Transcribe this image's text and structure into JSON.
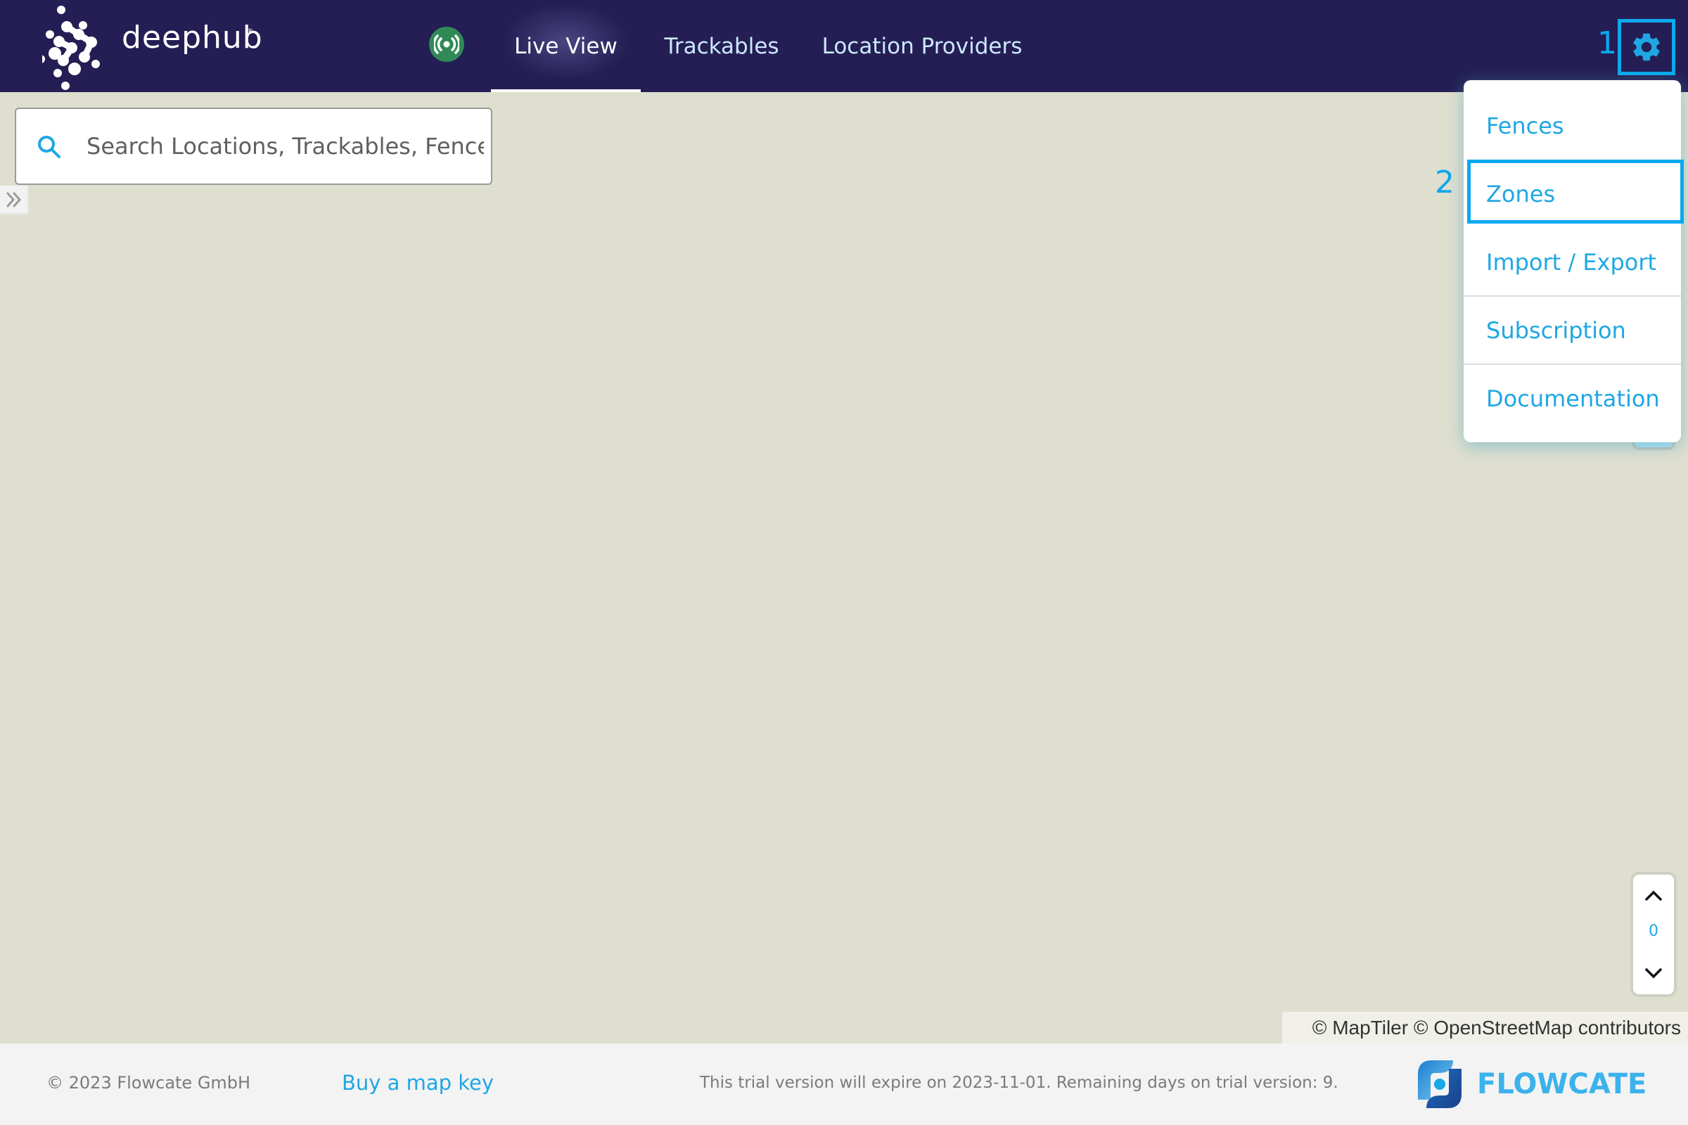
{
  "header": {
    "brand": "deephub",
    "brand_mark": "®",
    "status_icon": "broadcast-icon",
    "nav": [
      {
        "label": "Live View",
        "active": true
      },
      {
        "label": "Trackables",
        "active": false
      },
      {
        "label": "Location Providers",
        "active": false
      }
    ],
    "settings_icon": "gear-icon"
  },
  "annotations": {
    "step1": "1",
    "step2": "2",
    "highlight_color": "#0aa9ee"
  },
  "settings_menu": {
    "items": [
      {
        "label": "Fences"
      },
      {
        "label": "Zones"
      },
      {
        "label": "Import / Export"
      },
      {
        "label": "Subscription"
      },
      {
        "label": "Documentation"
      }
    ]
  },
  "map": {
    "search": {
      "placeholder": "Search Locations, Trackables, Fences",
      "value": ""
    },
    "expand_icon": "double-chevron-right-icon",
    "floor_control": {
      "value": "0"
    },
    "attribution": {
      "maptiler": "© MapTiler",
      "osm": "© OpenStreetMap contributors"
    }
  },
  "footer": {
    "copyright": "© 2023 Flowcate GmbH",
    "buy_link": "Buy a map key",
    "trial_notice": "This trial version will expire on 2023-11-01. Remaining days on trial version: 9.",
    "company_logo": "FLOWCATE"
  },
  "colors": {
    "header_bg": "#241e55",
    "accent": "#1ea7e3",
    "status_green": "#2f8a56",
    "map_bg": "#dfdfd0"
  }
}
